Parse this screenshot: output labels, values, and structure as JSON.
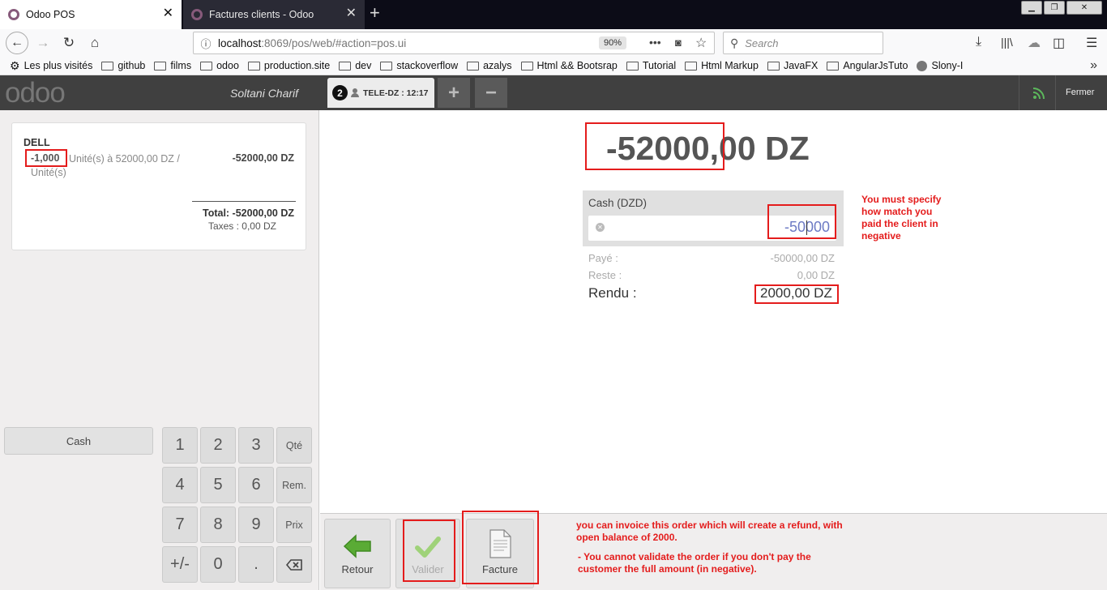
{
  "browser": {
    "tabs": [
      {
        "title": "Odoo POS"
      },
      {
        "title": "Factures clients - Odoo"
      }
    ],
    "url_host": "localhost",
    "url_rest": ":8069/pos/web/#action=pos.ui",
    "zoom": "90%",
    "search_placeholder": "Search",
    "bookmarks": [
      "Les plus visités",
      "github",
      "films",
      "odoo",
      "production.site",
      "dev",
      "stackoverflow",
      "azalys",
      "Html && Bootsrap",
      "Tutorial",
      "Html Markup",
      "JavaFX",
      "AngularJsTuto",
      "Slony-I"
    ]
  },
  "pos": {
    "logo": "odoo",
    "cashier": "Soltani Charif",
    "order_number": "2",
    "order_label": "TELE-DZ : 12:17",
    "add_order": "+",
    "remove_order": "−",
    "close_label": "Fermer",
    "orderline": {
      "product": "DELL",
      "qty": "-1,000",
      "unit_info_1": "Unité(s) à 52000,00 DZ /",
      "unit_info_2": "Unité(s)",
      "price": "-52000,00 DZ"
    },
    "total": "Total: -52000,00 DZ",
    "taxes": "Taxes : 0,00 DZ",
    "payment_method": "Cash",
    "numpad": {
      "k1": "1",
      "k2": "2",
      "k3": "3",
      "qty": "Qté",
      "k4": "4",
      "k5": "5",
      "k6": "6",
      "disc": "Rem.",
      "k7": "7",
      "k8": "8",
      "k9": "9",
      "price": "Prix",
      "sign": "+/-",
      "k0": "0",
      "dot": "."
    },
    "due_amount": "-52000,00 DZ",
    "paymentline": {
      "label": "Cash (DZD)",
      "value": "-50000"
    },
    "summary": {
      "paid_label": "Payé :",
      "paid_value": "-50000,00 DZ",
      "remaining_label": "Reste :",
      "remaining_value": "0,00 DZ",
      "change_label": "Rendu :",
      "change_value": "2000,00 DZ"
    },
    "actions": {
      "back": "Retour",
      "validate": "Valider",
      "invoice": "Facture"
    }
  },
  "annotations": {
    "note_payment": "You must specify how match you paid the client in negative",
    "note_invoice_1": "you can invoice this order which will create a refund, with open balance of 2000.",
    "note_invoice_2": "- You cannot validate the order if you don't pay the customer the full amount (in negative)."
  },
  "colors": {
    "odoo_purple": "#875a7b",
    "annotation_red": "#e41c1c",
    "header_dark": "#404040",
    "validate_green": "#7fbf4a"
  }
}
